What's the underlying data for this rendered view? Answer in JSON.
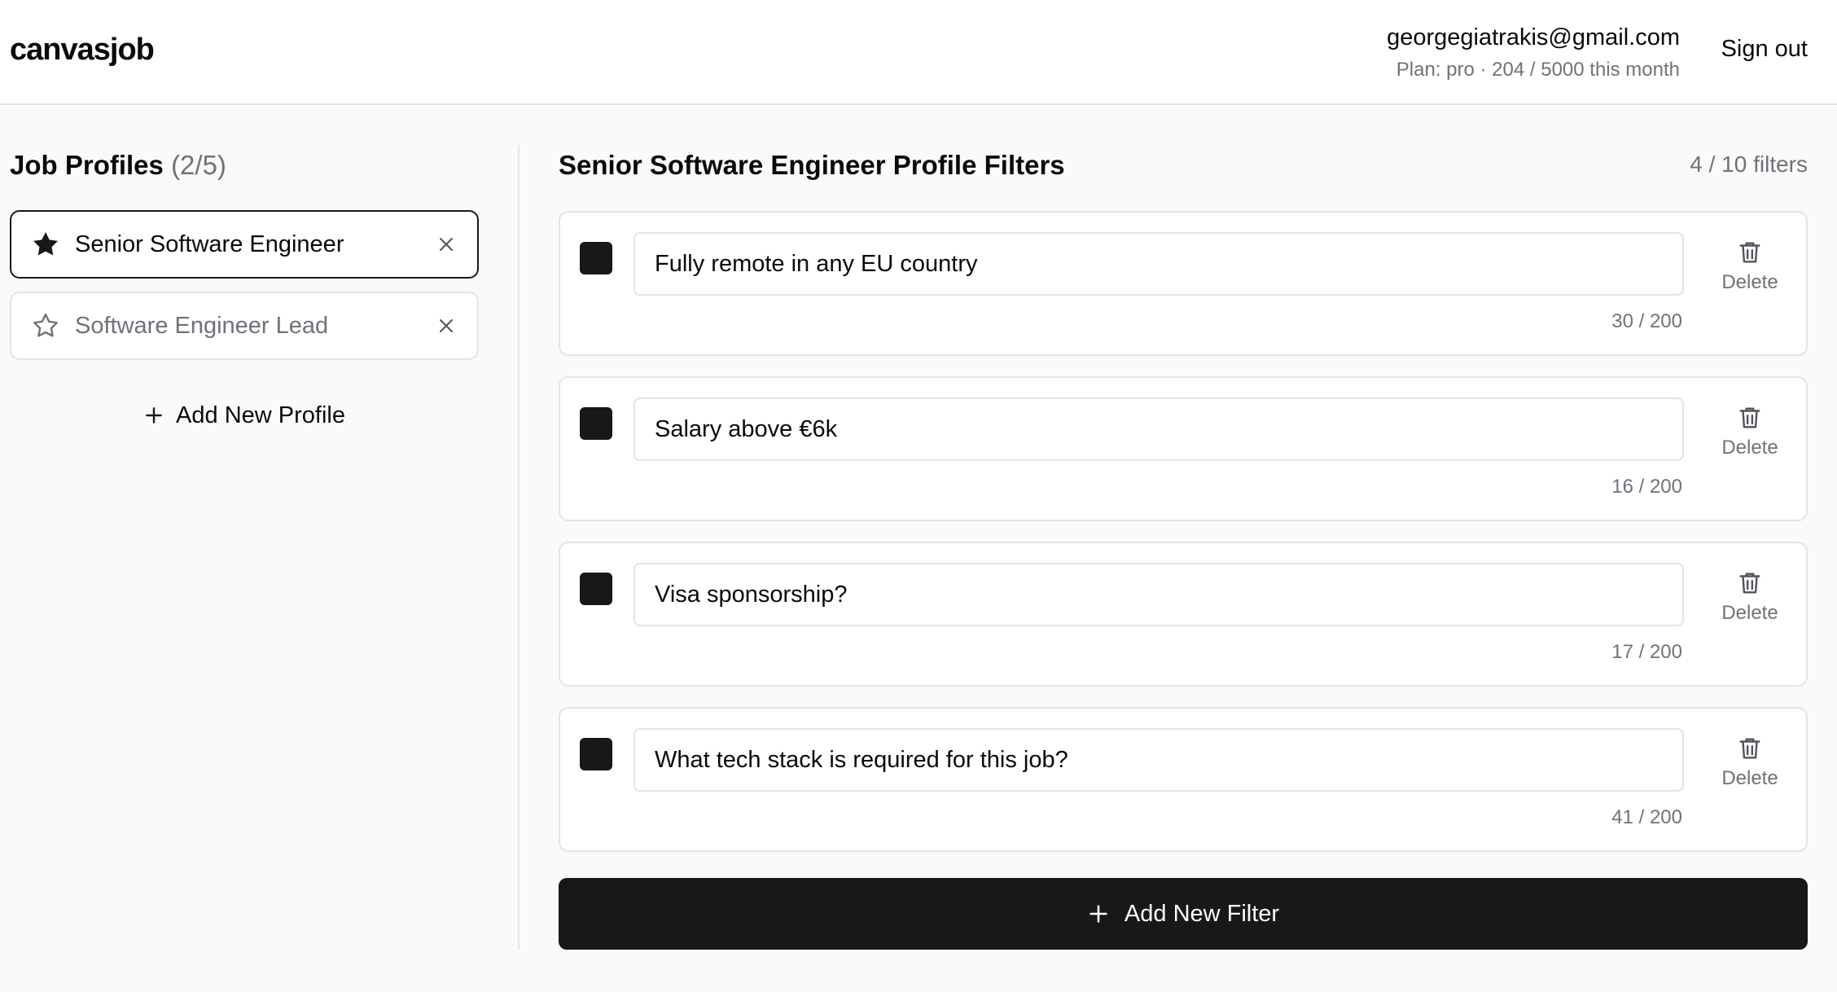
{
  "header": {
    "brand": "canvasjob",
    "email": "georgegiatrakis@gmail.com",
    "plan": "Plan: pro · 204 / 5000 this month",
    "signout_label": "Sign out"
  },
  "profiles": {
    "title": "Job Profiles",
    "count": "(2/5)",
    "items": [
      {
        "label": "Senior Software Engineer",
        "icon": "star-filled-icon",
        "active": true
      },
      {
        "label": "Software Engineer Lead",
        "icon": "star-outline-icon",
        "active": false
      }
    ],
    "add_label": "Add New Profile"
  },
  "filters": {
    "title": "Senior Software Engineer Profile Filters",
    "count": "4 / 10 filters",
    "items": [
      {
        "text": "Fully remote in any EU country",
        "chars": "30 / 200",
        "checked": true
      },
      {
        "text": "Salary above €6k",
        "chars": "16 / 200",
        "checked": true
      },
      {
        "text": "Visa sponsorship?",
        "chars": "17 / 200",
        "checked": true
      },
      {
        "text": "What tech stack is required for this job?",
        "chars": "41 / 200",
        "checked": true
      }
    ],
    "delete_label": "Delete",
    "add_label": "Add New Filter"
  },
  "colors": {
    "accent": "#18181b",
    "muted_text": "#71717a",
    "border": "#e4e4e7",
    "background": "#fafafa"
  }
}
